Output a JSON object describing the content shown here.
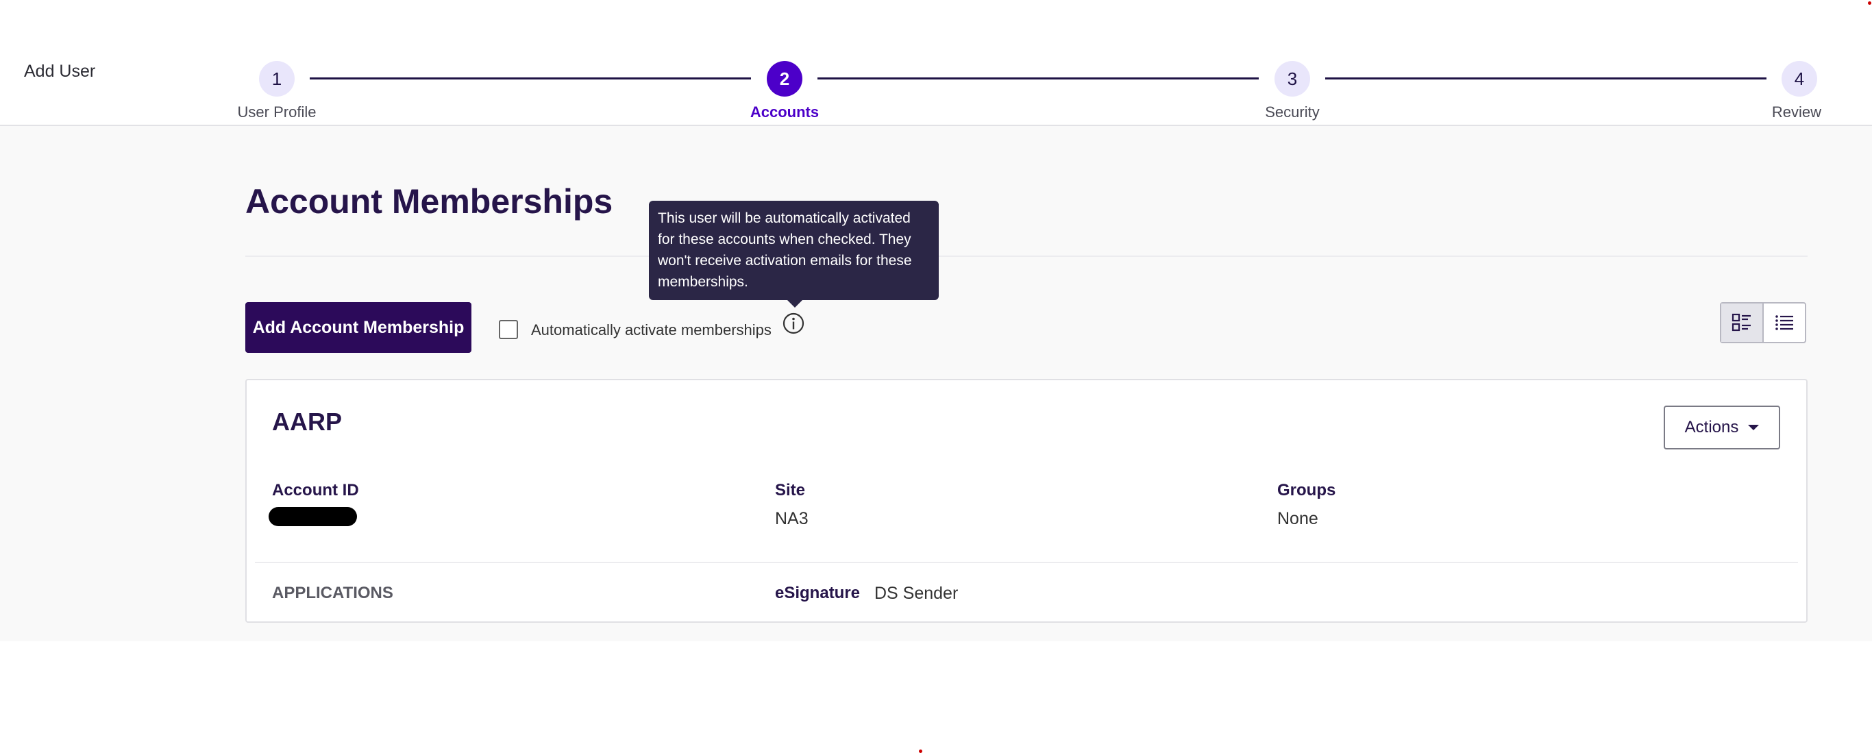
{
  "header": {
    "title": "Add User"
  },
  "stepper": {
    "steps": [
      {
        "number": "1",
        "label": "User Profile",
        "active": false
      },
      {
        "number": "2",
        "label": "Accounts",
        "active": true
      },
      {
        "number": "3",
        "label": "Security",
        "active": false
      },
      {
        "number": "4",
        "label": "Review",
        "active": false
      }
    ]
  },
  "main": {
    "title": "Account Memberships",
    "add_button_label": "Add Account Membership",
    "auto_activate_label": "Automatically activate memberships",
    "auto_activate_checked": false,
    "tooltip_text": "This user will be automatically activated for these accounts when checked. They won't receive activation emails for these memberships.",
    "view_toggle": {
      "options": [
        "card-view-icon",
        "list-view-icon"
      ],
      "selected": "card-view-icon"
    }
  },
  "card": {
    "title": "AARP",
    "actions_label": "Actions",
    "fields": [
      {
        "label": "Account ID",
        "value": ""
      },
      {
        "label": "Site",
        "value": "NA3"
      },
      {
        "label": "Groups",
        "value": "None"
      }
    ],
    "applications_label": "APPLICATIONS",
    "application": {
      "name": "eSignature",
      "role": "DS Sender"
    }
  },
  "colors": {
    "accent": "#4c00c9",
    "primary_button": "#2c0a5a",
    "tooltip_bg": "#2b2646",
    "content_bg": "#f9f9f9"
  }
}
